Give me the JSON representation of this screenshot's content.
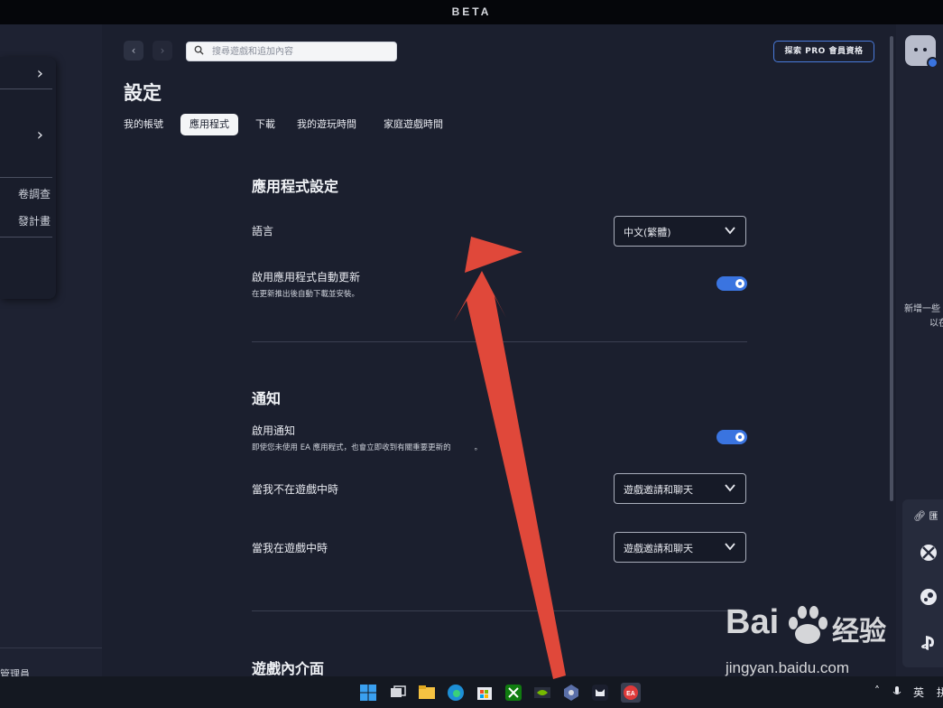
{
  "window": {
    "banner": "BETA"
  },
  "left_panel": {
    "items": [
      {
        "label": "",
        "has_chevron": true
      },
      {
        "label": "",
        "has_chevron": true
      },
      {
        "label": "卷調查",
        "has_chevron": false
      },
      {
        "label": "發計畫",
        "has_chevron": false
      }
    ],
    "footer_label": "管理員"
  },
  "header": {
    "search_placeholder": "搜尋遊戲和追加內容",
    "pro_button": "探索 PRO 會員資格"
  },
  "page_title": "設定",
  "tabs": [
    {
      "label": "我的帳號",
      "active": false
    },
    {
      "label": "應用程式",
      "active": true
    },
    {
      "label": "下載",
      "active": false
    },
    {
      "label": "我的遊玩時間",
      "active": false
    },
    {
      "label": "家庭遊戲時間",
      "active": false
    }
  ],
  "app_settings": {
    "title": "應用程式設定",
    "language_label": "語言",
    "language_value": "中文(繁體)",
    "auto_update_label": "啟用應用程式自動更新",
    "auto_update_desc": "在更新推出後自動下載並安裝。",
    "auto_update_on": true
  },
  "notifications": {
    "title": "通知",
    "enable_label": "啟用通知",
    "enable_desc": "即使您未使用 EA 應用程式，也會立即收到有關重要更新的",
    "enable_desc_tail": "。",
    "enable_on": true,
    "not_in_game_label": "當我不在遊戲中時",
    "not_in_game_value": "遊戲邀請和聊天",
    "in_game_label": "當我在遊戲中時",
    "in_game_value": "遊戲邀請和聊天"
  },
  "in_game_overlay": {
    "title": "遊戲內介面"
  },
  "right_panel": {
    "text_line1": "新增一些",
    "text_line2": "以在",
    "link_label": "匯",
    "platform_icons": [
      "xbox-icon",
      "steam-icon",
      "playstation-icon"
    ]
  },
  "taskbar": {
    "apps": [
      "windows-start-icon",
      "task-view-icon",
      "file-explorer-icon",
      "edge-icon",
      "microsoft-store-icon",
      "xbox-app-icon",
      "nvidia-icon",
      "app-icon",
      "cat-app-icon",
      "ea-app-icon"
    ],
    "ime_label": "英",
    "tray_tail": "拼"
  },
  "watermark": {
    "brand": "Bai",
    "brand_cn": "经验",
    "url": "jingyan.baidu.com"
  },
  "colors": {
    "accent": "#3a74e0",
    "annotation_arrow": "#e0483a",
    "background": "#1b1f2e"
  }
}
